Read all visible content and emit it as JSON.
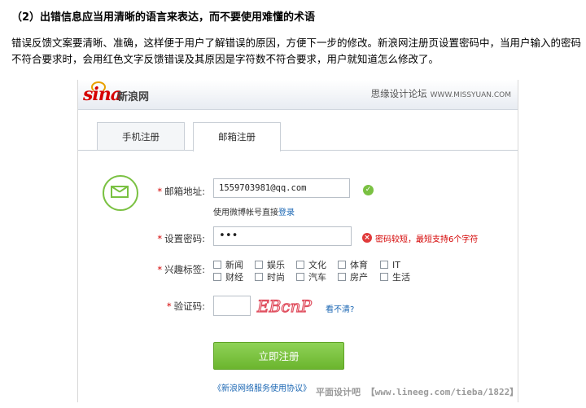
{
  "heading": "（2）出错信息应当用清晰的语言来表达，而不要使用难懂的术语",
  "paragraph": "错误反馈文案要清晰、准确，这样便于用户了解错误的原因，方便下一步的修改。新浪网注册页设置密码中，当用户输入的密码不符合要求时，会用红色文字反馈错误及其原因是字符数不符合要求，用户就知道怎么修改了。",
  "screenshot": {
    "logo_text": "sina",
    "logo_cn": "新浪网",
    "watermark": "思缘设计论坛",
    "watermark_url": "WWW.MISSYUAN.COM",
    "tabs": [
      "手机注册",
      "邮箱注册"
    ],
    "form": {
      "email_label": "邮箱地址:",
      "email_value": "1559703981@qq.com",
      "email_hint": "使用微博帐号直接",
      "email_hint_link": "登录",
      "password_label": "设置密码:",
      "password_value": "•••",
      "password_error": "密码较短，最短支持6个字符",
      "interests_label": "兴趣标签:",
      "interests": [
        "新闻",
        "娱乐",
        "文化",
        "体育",
        "IT",
        "财经",
        "时尚",
        "汽车",
        "房产",
        "生活"
      ],
      "captcha_label": "验证码:",
      "captcha_text": "EBcnP",
      "captcha_refresh": "看不清?",
      "submit_label": "立即注册",
      "terms": "《新浪网络服务使用协议》"
    },
    "accent_color": "#7ac142",
    "error_color": "#d40000"
  },
  "bottom_watermark": "平面设计吧 【www.lineeg.com/tieba/1822】"
}
